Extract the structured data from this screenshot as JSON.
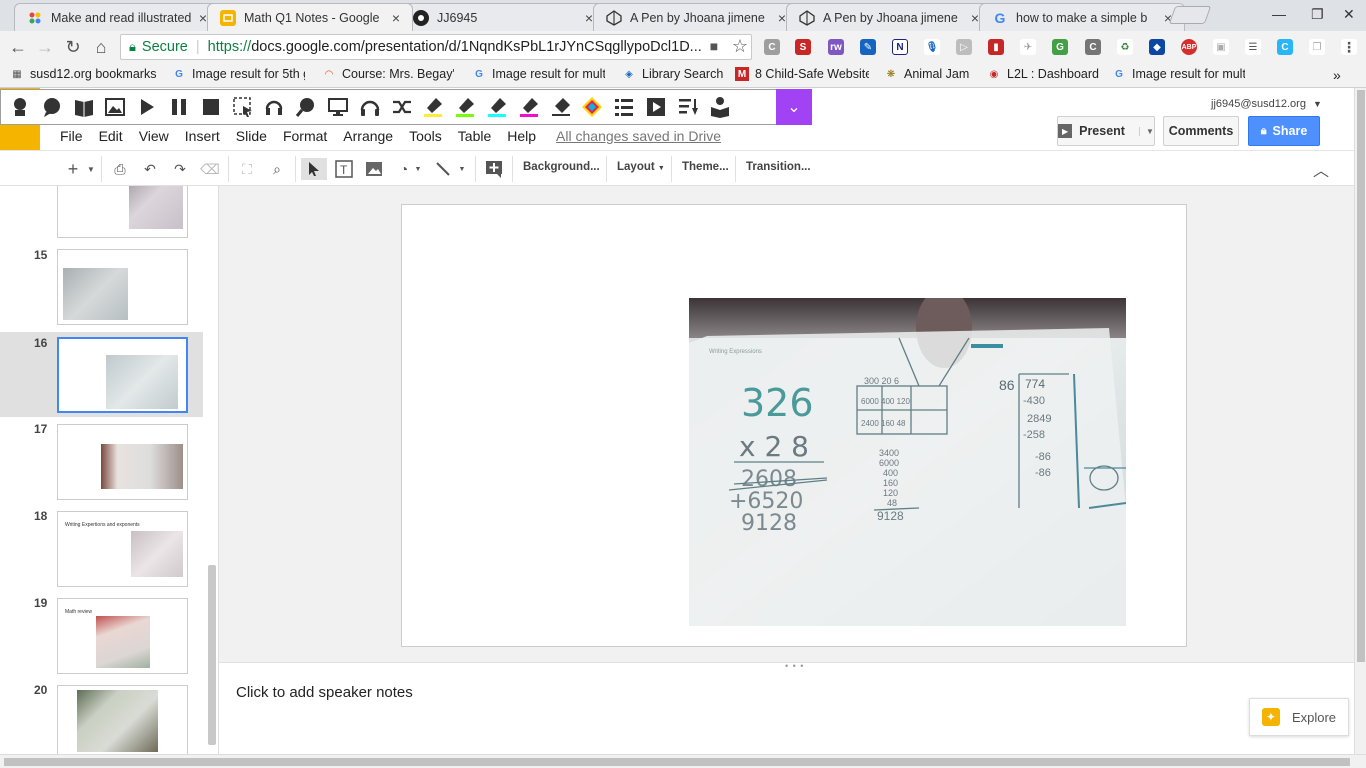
{
  "browser": {
    "tabs": [
      {
        "title": "Make and read illustrated",
        "icon": "multicolor-dots-icon",
        "color": "#f4b400"
      },
      {
        "title": "Math Q1 Notes - Google",
        "icon": "google-slides-icon",
        "color": "#f4b400",
        "active": true
      },
      {
        "title": "JJ6945",
        "icon": "github-icon",
        "color": "#222222"
      },
      {
        "title": "A Pen by Jhoana jimene",
        "icon": "codepen-icon",
        "color": "#333333"
      },
      {
        "title": "A Pen by Jhoana jimene",
        "icon": "codepen-icon",
        "color": "#333333"
      },
      {
        "title": "how to make a simple b",
        "icon": "google-g-icon",
        "color": "#4285f4"
      }
    ],
    "close_glyph": "×",
    "omnibox": {
      "secure_label": "Secure",
      "url_scheme": "https://",
      "url_rest": "docs.google.com/presentation/d/1NqndKsPbL1rJYnCSqgllypoDcl1D..."
    },
    "bookmarks": [
      {
        "label": "susd12.org bookmarks",
        "icon": "apps-grid-icon"
      },
      {
        "label": "Image result for 5th g",
        "icon": "google-g-icon"
      },
      {
        "label": "Course: Mrs. Begay's",
        "icon": "canvas-icon"
      },
      {
        "label": "Image result for mult",
        "icon": "google-g-icon"
      },
      {
        "label": "Library Search",
        "icon": "library-icon"
      },
      {
        "label": "8 Child-Safe Website",
        "icon": "red-m-icon"
      },
      {
        "label": "Animal Jam",
        "icon": "paw-icon"
      },
      {
        "label": "L2L : Dashboard",
        "icon": "l2l-icon"
      },
      {
        "label": "Image result for mult",
        "icon": "google-g-icon"
      }
    ],
    "bookmarks_overflow": "»"
  },
  "docs": {
    "menu": [
      "File",
      "Edit",
      "View",
      "Insert",
      "Slide",
      "Format",
      "Arrange",
      "Tools",
      "Table",
      "Help"
    ],
    "save_status": "All changes saved in Drive",
    "account": "jj6945@susd12.org",
    "present_label": "Present",
    "comments_label": "Comments",
    "share_label": "Share",
    "toolbar": {
      "background_label": "Background...",
      "layout_label": "Layout",
      "theme_label": "Theme...",
      "transition_label": "Transition..."
    },
    "slides": [
      {
        "num": "",
        "caption": ""
      },
      {
        "num": "15",
        "caption": ""
      },
      {
        "num": "16",
        "caption": "",
        "selected": true
      },
      {
        "num": "17",
        "caption": ""
      },
      {
        "num": "18",
        "caption": "Writing Expertions and exponents"
      },
      {
        "num": "19",
        "caption": "Math review"
      },
      {
        "num": "20",
        "caption": ""
      }
    ],
    "speaker_notes_placeholder": "Click to add speaker notes",
    "explore_label": "Explore"
  },
  "accent_colors": {
    "slides_yellow": "#f4b400",
    "share_blue": "#4d90fe",
    "selection_blue": "#4285f4",
    "extension_purple": "#a142f4"
  }
}
